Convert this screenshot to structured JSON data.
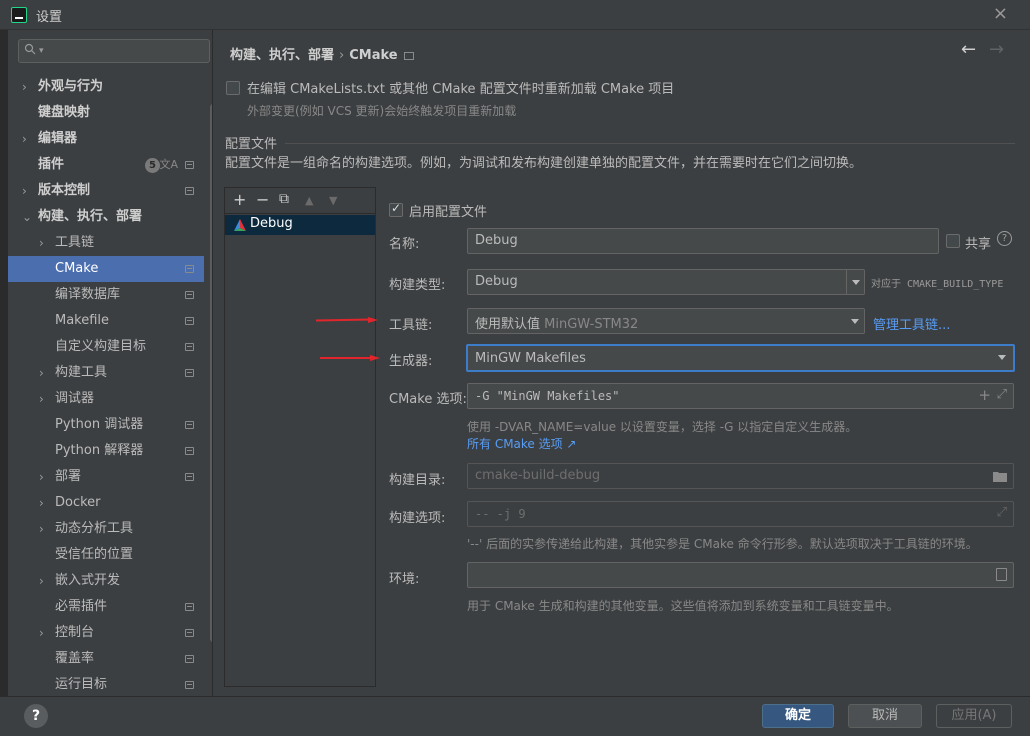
{
  "window": {
    "title": "设置",
    "close": "×"
  },
  "sidebar": {
    "items": [
      {
        "label": "外观与行为",
        "arrow": "›",
        "bold": true
      },
      {
        "label": "键盘映射",
        "bold": true
      },
      {
        "label": "编辑器",
        "arrow": "›",
        "bold": true
      },
      {
        "label": "插件",
        "bold": true,
        "badge": "5",
        "translate": "文A"
      },
      {
        "label": "版本控制",
        "arrow": "›",
        "bold": true
      },
      {
        "label": "构建、执行、部署",
        "arrow": "⌄",
        "bold": true
      },
      {
        "label": "工具链",
        "arrow": "›"
      },
      {
        "label": "CMake",
        "selected": true
      },
      {
        "label": "编译数据库"
      },
      {
        "label": "Makefile"
      },
      {
        "label": "自定义构建目标"
      },
      {
        "label": "构建工具",
        "arrow": "›"
      },
      {
        "label": "调试器",
        "arrow": "›"
      },
      {
        "label": "Python 调试器"
      },
      {
        "label": "Python 解释器"
      },
      {
        "label": "部署",
        "arrow": "›"
      },
      {
        "label": "Docker",
        "arrow": "›"
      },
      {
        "label": "动态分析工具",
        "arrow": "›"
      },
      {
        "label": "受信任的位置"
      },
      {
        "label": "嵌入式开发",
        "arrow": "›"
      },
      {
        "label": "必需插件"
      },
      {
        "label": "控制台",
        "arrow": "›"
      },
      {
        "label": "覆盖率"
      },
      {
        "label": "运行目标"
      }
    ]
  },
  "header": {
    "crumb1": "构建、执行、部署",
    "sep": "›",
    "crumb2": "CMake",
    "back": "←",
    "forward": "→"
  },
  "reload": {
    "label": "在编辑 CMakeLists.txt 或其他 CMake 配置文件时重新加载 CMake 项目",
    "hint": "外部变更(例如 VCS 更新)会始终触发项目重新加载"
  },
  "profiles_section": {
    "title": "配置文件",
    "description": "配置文件是一组命名的构建选项。例如，为调试和发布构建创建单独的配置文件，并在需要时在它们之间切换。"
  },
  "profiles_toolbar": {
    "add": "+",
    "remove": "−",
    "copy": "⧉",
    "up": "▲",
    "down": "▼"
  },
  "profiles": [
    {
      "name": "Debug"
    }
  ],
  "form": {
    "enable_label": "启用配置文件",
    "name_label": "名称:",
    "name_value": "Debug",
    "share_label": "共享",
    "help_icon": "?",
    "build_type_label": "构建类型:",
    "build_type_value": "Debug",
    "build_type_hint": "对应于 CMAKE_BUILD_TYPE",
    "toolchain_label": "工具链:",
    "toolchain_value": "使用默认值",
    "toolchain_default": "MinGW-STM32",
    "manage_toolchains": "管理工具链...",
    "generator_label": "生成器:",
    "generator_value": "MinGW Makefiles",
    "cmake_options_label": "CMake 选项:",
    "cmake_options_value": "-G \"MinGW Makefiles\"",
    "cmake_options_hint": "使用 -DVAR_NAME=value 以设置变量，选择 -G 以指定自定义生成器。",
    "all_cmake_options": "所有 CMake 选项 ↗",
    "build_dir_label": "构建目录:",
    "build_dir_placeholder": "cmake-build-debug",
    "build_options_label": "构建选项:",
    "build_options_placeholder": "-- -j 9",
    "build_options_hint": "'--' 后面的实参传递给此构建，其他实参是 CMake 命令行形参。默认选项取决于工具链的环境。",
    "env_label": "环境:",
    "env_value": "",
    "env_hint": "用于 CMake 生成和构建的其他变量。这些值将添加到系统变量和工具链变量中。",
    "plus": "+",
    "expand": "⤢"
  },
  "footer": {
    "help": "?",
    "ok": "确定",
    "cancel": "取消",
    "apply": "应用(A)"
  },
  "colors": {
    "background": "#3c3f41",
    "selection": "#4b6eaf",
    "link": "#589df6",
    "focus": "#3d7cc9",
    "annotation_arrow": "#e0262b"
  }
}
